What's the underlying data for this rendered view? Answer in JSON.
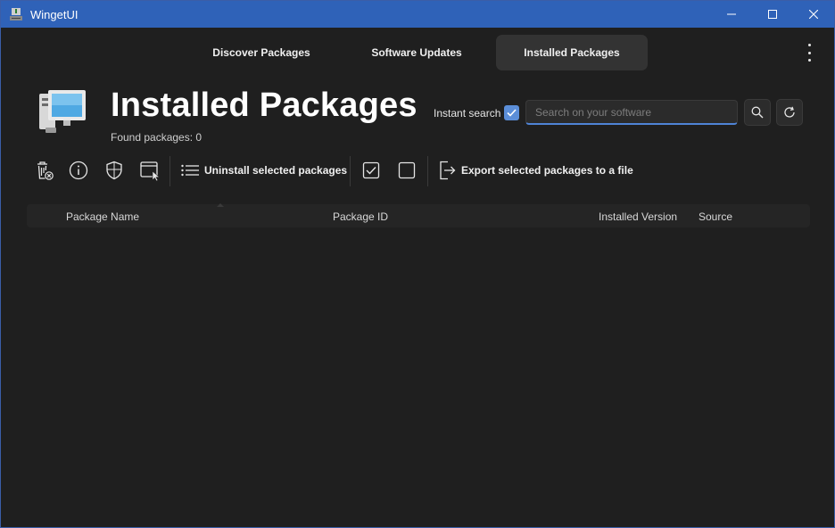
{
  "window": {
    "title": "WingetUI"
  },
  "tabs": [
    {
      "label": "Discover Packages",
      "active": false
    },
    {
      "label": "Software Updates",
      "active": false
    },
    {
      "label": "Installed Packages",
      "active": true
    }
  ],
  "header": {
    "title": "Installed Packages",
    "found_packages": "Found packages: 0",
    "instant_search_label": "Instant search",
    "instant_search_checked": true
  },
  "search": {
    "placeholder": "Search on your software",
    "value": ""
  },
  "toolbar": {
    "uninstall_label": "Uninstall selected packages",
    "export_label": "Export selected packages to a file"
  },
  "table": {
    "columns": [
      "Package Name",
      "Package ID",
      "Installed Version",
      "Source"
    ],
    "rows": []
  },
  "colors": {
    "titlebar": "#2f62b8",
    "accent": "#5b8ed8",
    "background": "#1f1f1f"
  },
  "icons": [
    "app-icon",
    "minimize-icon",
    "maximize-icon",
    "close-icon",
    "more-options-icon",
    "computer-icon",
    "search-icon",
    "refresh-icon",
    "uninstall-icon",
    "info-icon",
    "shield-icon",
    "window-cursor-icon",
    "list-icon",
    "check-all-icon",
    "uncheck-all-icon",
    "export-icon"
  ]
}
